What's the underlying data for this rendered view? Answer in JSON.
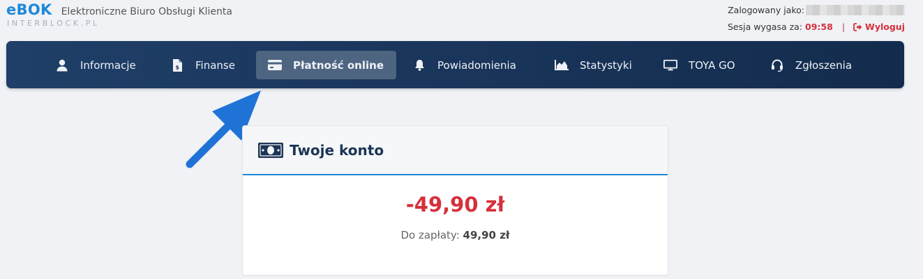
{
  "header": {
    "logo": "eBOK",
    "subtitle": "Elektroniczne Biuro Obsługi Klienta",
    "domain": "INTERBLOCK.PL",
    "logged_label": "Zalogowany jako:",
    "session_label": "Sesja wygasa za:",
    "session_time": "09:58",
    "separator": "|",
    "logout_label": "Wyloguj"
  },
  "nav": {
    "items": [
      {
        "label": "Informacje",
        "icon": "user-icon"
      },
      {
        "label": "Finanse",
        "icon": "invoice-icon"
      },
      {
        "label": "Płatność online",
        "icon": "credit-card-icon",
        "active": true
      },
      {
        "label": "Powiadomienia",
        "icon": "bell-icon"
      },
      {
        "label": "Statystyki",
        "icon": "area-chart-icon"
      },
      {
        "label": "TOYA GO",
        "icon": "monitor-icon"
      },
      {
        "label": "Zgłoszenia",
        "icon": "headset-icon"
      }
    ]
  },
  "account": {
    "icon": "money-bill-icon",
    "title": "Twoje konto",
    "balance": "-49,90 zł",
    "due_label": "Do zapłaty:",
    "due_amount": "49,90 zł"
  },
  "colors": {
    "brand": "#1e88d8",
    "nav_bg": "#1a355b",
    "nav_active": "#4e6581",
    "negative": "#d6303c",
    "arrow": "#1f73d6"
  }
}
